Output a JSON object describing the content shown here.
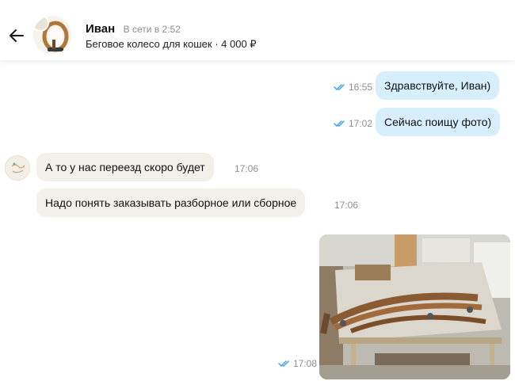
{
  "header": {
    "name": "Иван",
    "status": "В сети в 2:52",
    "listing": "Беговое колесо для кошек · 4 000 ₽"
  },
  "messages": [
    {
      "direction": "out",
      "text": "Здравствуйте, Иван)",
      "time": "16:55",
      "read": true
    },
    {
      "direction": "out",
      "text": "Сейчас поищу фото)",
      "time": "17:02",
      "read": true
    },
    {
      "direction": "in",
      "text": "А то у нас переезд скоро будет",
      "time": "17:06"
    },
    {
      "direction": "in",
      "text": "Надо понять заказывать разборное или сборное",
      "time": "17:06"
    },
    {
      "direction": "out",
      "type": "photo",
      "time": "17:08",
      "read": true
    }
  ],
  "icons": {
    "back": "arrow-left-icon",
    "read_receipt": "double-check-icon"
  },
  "colors": {
    "outgoing_bubble": "#d7eefc",
    "incoming_bubble": "#f3f0ea",
    "check": "#3aa0e6"
  }
}
